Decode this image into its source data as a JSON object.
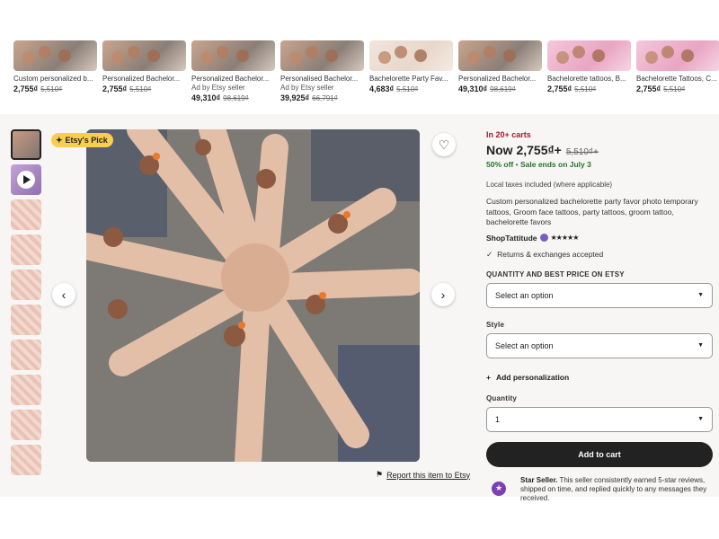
{
  "related_items": [
    {
      "title": "Custom personalized b...",
      "ad": "",
      "price": "2,755₫",
      "old_price": "5,510₫",
      "style": "photo"
    },
    {
      "title": "Personalized Bachelor...",
      "ad": "",
      "price": "2,755₫",
      "old_price": "5,510₫",
      "style": "photo"
    },
    {
      "title": "Personalized Bachelor...",
      "ad": "Ad by Etsy seller",
      "price": "49,310₫",
      "old_price": "98,619₫",
      "style": "photo"
    },
    {
      "title": "Personalised Bachelor...",
      "ad": "Ad by Etsy seller",
      "price": "39,925₫",
      "old_price": "66,791₫",
      "style": "photo"
    },
    {
      "title": "Bachelorette Party Fav...",
      "ad": "",
      "price": "4,683₫",
      "old_price": "5,510₫",
      "style": "paper"
    },
    {
      "title": "Personalized Bachelor...",
      "ad": "",
      "price": "49,310₫",
      "old_price": "98,619₫",
      "style": "photo"
    },
    {
      "title": "Bachelorette tattoos, B...",
      "ad": "",
      "price": "2,755₫",
      "old_price": "5,510₫",
      "style": "pink"
    },
    {
      "title": "Bachelorette Tattoos, C...",
      "ad": "",
      "price": "2,755₫",
      "old_price": "5,510₫",
      "style": "pink"
    }
  ],
  "gallery": {
    "badge": "Etsy's Pick",
    "thumbnail_count": 10,
    "report_link": "Report this item to Etsy",
    "prev_icon": "chevron-left-icon",
    "next_icon": "chevron-right-icon",
    "favorite_icon": "heart-icon"
  },
  "listing": {
    "in_carts": "In 20+ carts",
    "price_prefix": "Now",
    "price": "2,755₫+",
    "old_price": "5,510₫+",
    "discount": "50% off",
    "sale_ends": "Sale ends on July 3",
    "taxes": "Local taxes included (where applicable)",
    "title": "Custom personalized bachelorette party favor photo temporary tattoos, Groom face tattoos, party tattoos, groom tattoo, bachelorette favors",
    "shop_name": "ShopTattitude",
    "stars": "★★★★★",
    "returns": "Returns & exchanges accepted",
    "quantity_price_label": "QUANTITY AND BEST PRICE ON ETSY",
    "option_placeholder": "Select an option",
    "style_label": "Style",
    "style_placeholder": "Select an option",
    "add_personalization": "Add personalization",
    "quantity_label": "Quantity",
    "quantity_value": "1",
    "add_to_cart": "Add to cart",
    "star_seller_title": "Star Seller.",
    "star_seller_text": "This seller consistently earned 5-star reviews, shipped on time, and replied quickly to any messages they received."
  },
  "colors": {
    "in_carts": "#a61a2e",
    "sale_green": "#24742c",
    "badge_yellow": "#f8cf4c",
    "star_seller_purple": "#7d3fb5",
    "button_dark": "#222222"
  }
}
